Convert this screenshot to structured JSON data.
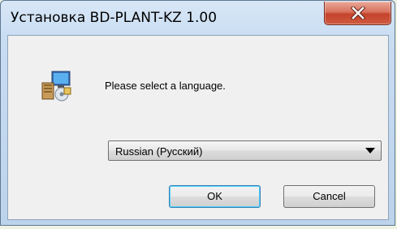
{
  "window": {
    "title": "Установка BD-PLANT-KZ 1.00"
  },
  "icons": {
    "setup": "setup-installer-icon",
    "close": "close-icon",
    "dropdown": "chevron-down-icon"
  },
  "dialog": {
    "prompt": "Please select a language.",
    "language": {
      "selected": "Russian (Русский)"
    },
    "ok_label": "OK",
    "cancel_label": "Cancel"
  },
  "colors": {
    "close_button": "#c4432b",
    "default_button_border": "#3c7fb1",
    "dialog_background": "#f0f0f0"
  }
}
